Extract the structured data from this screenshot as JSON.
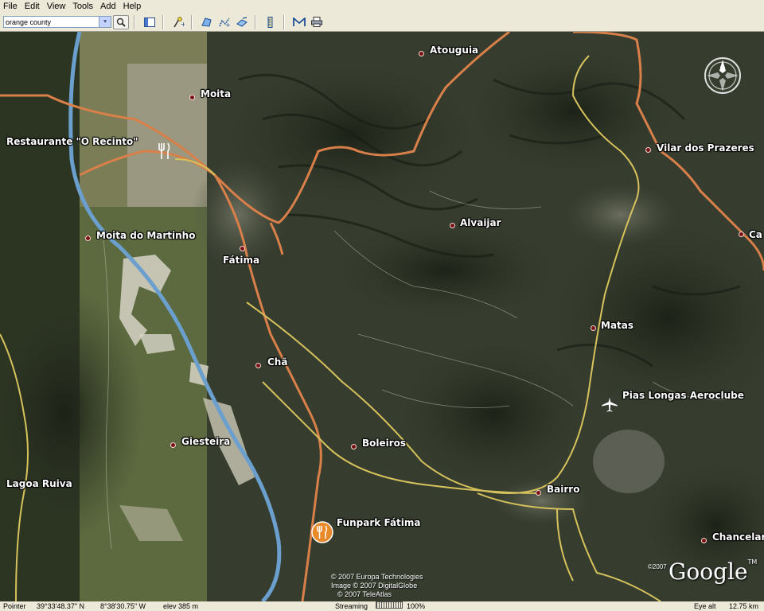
{
  "menu": [
    "File",
    "Edit",
    "View",
    "Tools",
    "Add",
    "Help"
  ],
  "toolbar": {
    "search_value": "orange county",
    "search_icon": "magnifier-icon",
    "buttons": [
      "sidebar-toggle-icon",
      "placemark-icon",
      "polygon-icon",
      "path-icon",
      "overlay-icon",
      "ruler-icon",
      "email-icon",
      "print-icon"
    ]
  },
  "places": {
    "atouguia": "Atouguia",
    "moita": "Moita",
    "restaurante": "Restaurante \"O Recinto\"",
    "vilar": "Vilar dos Prazeres",
    "alvaijar": "Alvaijar",
    "moita_martinho": "Moita do Martinho",
    "fatima": "Fátima",
    "ca": "Ca",
    "matas": "Matas",
    "cha": "Chã",
    "pias": "Pias Longas Aeroclube",
    "giesteira": "Giesteira",
    "boleiros": "Boleiros",
    "lagoa": "Lagoa Ruiva",
    "bairro": "Bairro",
    "funpark": "Funpark Fátima",
    "chancelaria": "Chancelar"
  },
  "copyright": {
    "line1": "© 2007 Europa Technologies",
    "line2": "Image © 2007 DigitalGlobe",
    "line3": "© 2007 TeleAtlas",
    "google": "Google",
    "tm": "TM",
    "google_year": "©2007"
  },
  "status": {
    "pointer_label": "Pointer",
    "lat": "39°33'48.37\" N",
    "lon": "8°38'30.75\" W",
    "elev": "elev  385 m",
    "streaming_label": "Streaming",
    "streaming_pct": "100%",
    "eye_alt_label": "Eye alt",
    "eye_alt": "12.75 km"
  },
  "colors": {
    "major_road": "#d9804a",
    "minor_road": "#d6c25c",
    "highway": "#5a9bd5",
    "place_dot": "#7a1010"
  }
}
